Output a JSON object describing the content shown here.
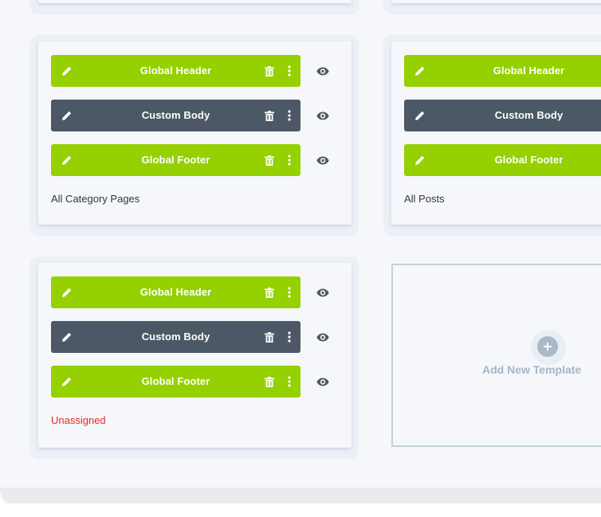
{
  "cards": [
    {
      "rows": [
        {
          "label": "Global Header",
          "variant": "green"
        },
        {
          "label": "Custom Body",
          "variant": "dark"
        },
        {
          "label": "Global Footer",
          "variant": "green"
        }
      ],
      "caption": "All Category Pages",
      "caption_color": "#32373c"
    },
    {
      "rows": [
        {
          "label": "Global Header",
          "variant": "green"
        },
        {
          "label": "Custom Body",
          "variant": "dark"
        },
        {
          "label": "Global Footer",
          "variant": "green"
        }
      ],
      "caption": "All Posts",
      "caption_color": "#32373c"
    },
    {
      "rows": [
        {
          "label": "Global Header",
          "variant": "green"
        },
        {
          "label": "Custom Body",
          "variant": "dark"
        },
        {
          "label": "Global Footer",
          "variant": "green"
        }
      ],
      "caption": "Unassigned",
      "caption_color": "#e02b20"
    }
  ],
  "add_template": {
    "label": "Add New Template",
    "icon": "plus-icon"
  },
  "colors": {
    "green": "#95d100",
    "dark": "#4c5866",
    "page_bg": "#f5f7fa",
    "unassigned": "#e02b20",
    "add_label": "#a7b6c6"
  },
  "icons": {
    "edit": "pencil-icon",
    "delete": "trash-icon",
    "more": "kebab-icon",
    "preview": "eye-icon"
  }
}
